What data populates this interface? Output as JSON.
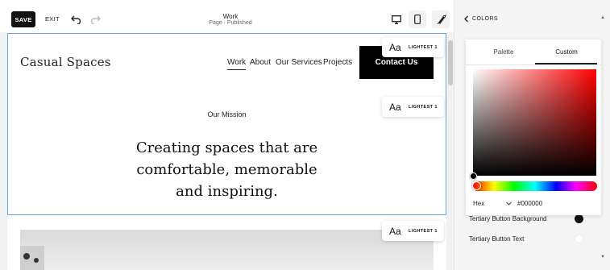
{
  "toolbar": {
    "save_label": "SAVE",
    "exit_label": "EXIT",
    "page_title": "Work",
    "page_status": "Page · Published"
  },
  "site": {
    "logo": "Casual Spaces",
    "nav": [
      "Work",
      "About",
      "Our Services",
      "Projects"
    ],
    "cta": "Contact Us"
  },
  "badges": {
    "aa": "Aa",
    "theme": "LIGHTEST 1"
  },
  "content": {
    "mission_label": "Our Mission",
    "headline_1": "Creating spaces that are",
    "headline_2": "comfortable, memorable",
    "headline_3": "and inspiring."
  },
  "panel": {
    "back_label": "COLORS",
    "tabs": [
      "Palette",
      "Custom"
    ],
    "active_tab": "Custom",
    "format": "Hex",
    "hex": "#000000",
    "settings": [
      {
        "label": "Tertiary Button Background",
        "swatch": "#111111"
      },
      {
        "label": "Tertiary Button Text",
        "swatch": "#ffffff"
      }
    ]
  },
  "colors": {
    "accent": "#5fa8e0",
    "button_dark": "#111111"
  }
}
